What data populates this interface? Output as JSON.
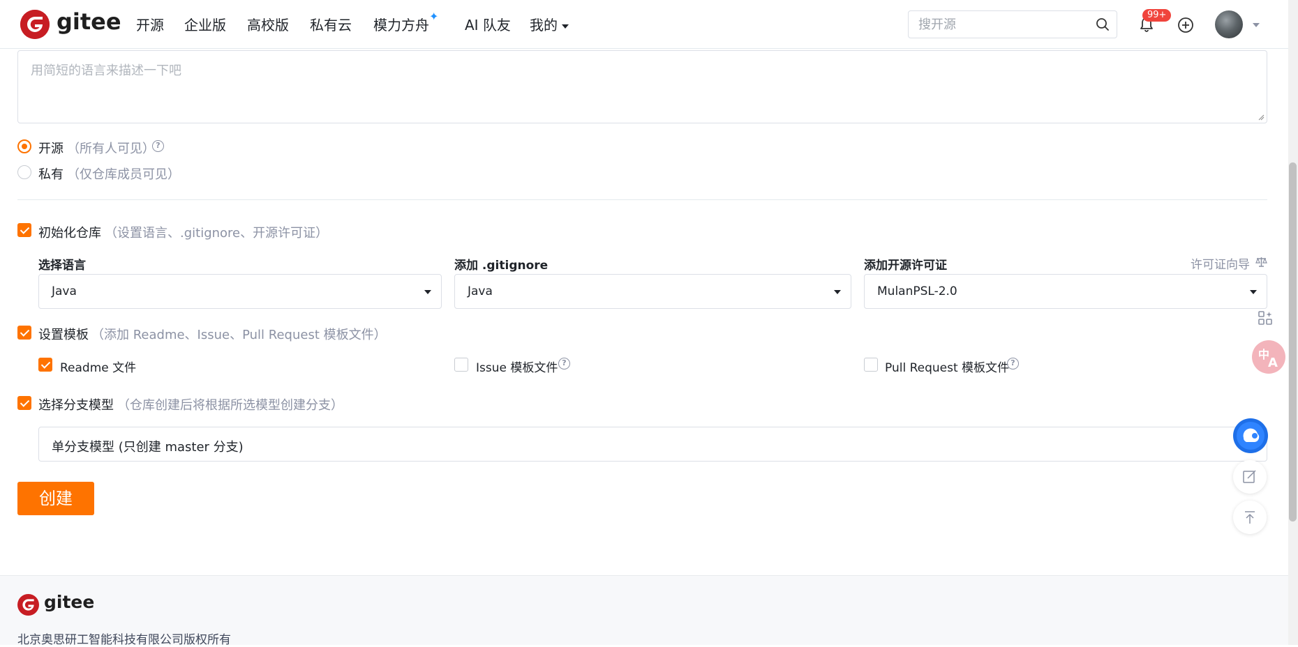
{
  "header": {
    "logo_text": "gitee",
    "logo_letter": "G",
    "nav": [
      "开源",
      "企业版",
      "高校版",
      "私有云",
      "模力方舟",
      "AI 队友",
      "我的"
    ],
    "sparkle": "✦",
    "search_placeholder": "搜开源",
    "notification_badge": "99+"
  },
  "form": {
    "description_placeholder": "用简短的语言来描述一下吧",
    "visibility": {
      "public_label": "开源",
      "public_hint": "（所有人可见）",
      "private_label": "私有",
      "private_hint": "（仅仓库成员可见）",
      "selected": "public"
    },
    "init_repo": {
      "label": "初始化仓库",
      "hint": "（设置语言、.gitignore、开源许可证）",
      "checked": true
    },
    "language": {
      "label": "选择语言",
      "value": "Java"
    },
    "gitignore": {
      "label": "添加 .gitignore",
      "value": "Java"
    },
    "license": {
      "label": "添加开源许可证",
      "value": "MulanPSL-2.0",
      "guide_link": "许可证向导"
    },
    "template": {
      "label": "设置模板",
      "hint": "（添加 Readme、Issue、Pull Request 模板文件）",
      "checked": true,
      "readme_label": "Readme 文件",
      "readme_checked": true,
      "issue_label": "Issue 模板文件",
      "issue_checked": false,
      "pr_label": "Pull Request 模板文件",
      "pr_checked": false
    },
    "branch": {
      "label": "选择分支模型",
      "hint": "（仓库创建后将根据所选模型创建分支）",
      "checked": true,
      "value": "单分支模型 (只创建 master 分支)"
    },
    "submit_label": "创建"
  },
  "footer": {
    "logo_text": "gitee",
    "copyright": "北京奥思研工智能科技有限公司版权所有"
  },
  "colors": {
    "brand_red": "#c71d23",
    "accent_orange": "#fe7300",
    "badge_red": "#f0443c"
  }
}
